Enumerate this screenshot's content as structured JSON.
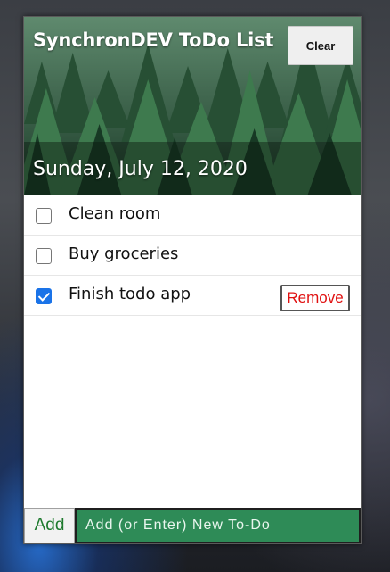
{
  "header": {
    "title": "SynchronDEV ToDo List",
    "clear_label": "Clear",
    "date": "Sunday, July 12, 2020"
  },
  "todos": [
    {
      "text": "Clean room",
      "checked": false
    },
    {
      "text": "Buy groceries",
      "checked": false
    },
    {
      "text": "Finish todo app",
      "checked": true,
      "remove_label": "Remove"
    }
  ],
  "footer": {
    "add_label": "Add",
    "input_placeholder": "Add (or Enter) New To-Do",
    "input_value": ""
  },
  "colors": {
    "check_accent": "#1a73e8",
    "remove_text": "#e01010",
    "add_text": "#1e7a2e",
    "input_background": "#2e8b57"
  },
  "icons": {
    "header_background": "forest-image",
    "checkbox": "checkbox-icon"
  }
}
